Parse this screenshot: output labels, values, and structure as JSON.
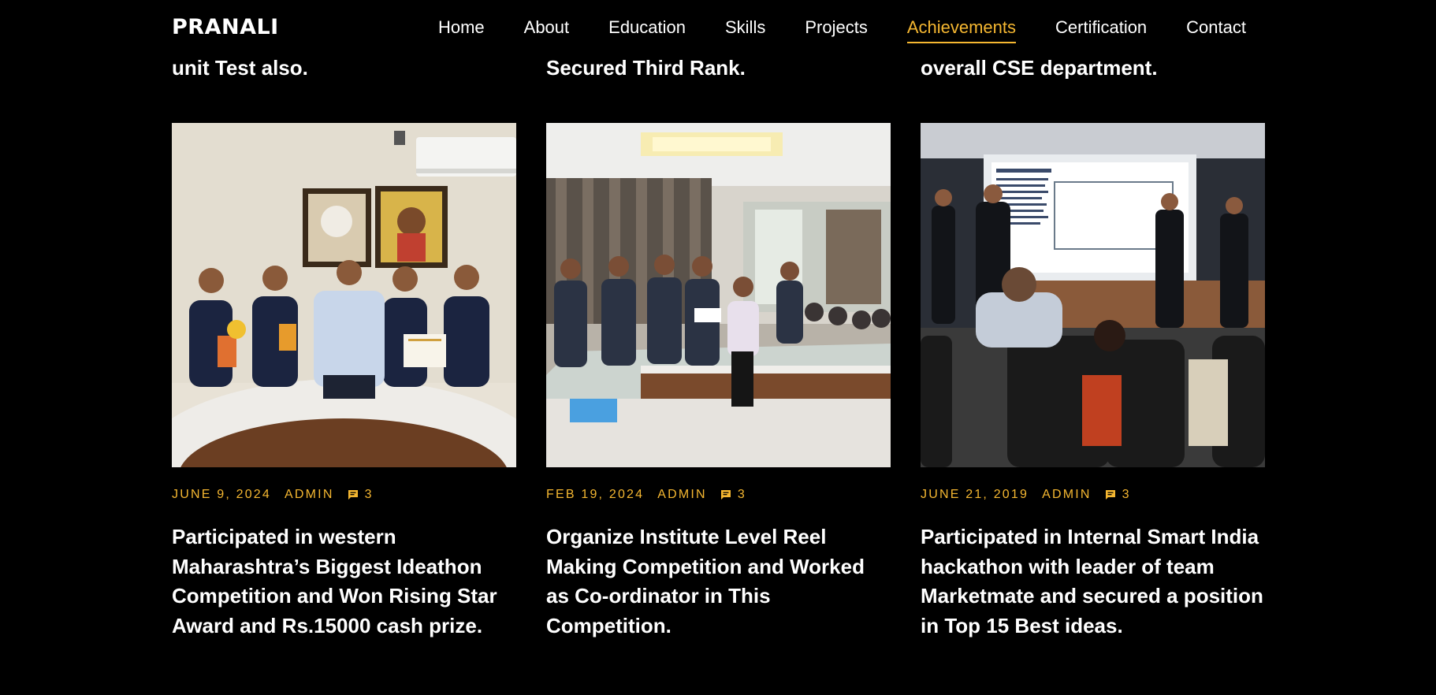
{
  "header": {
    "logo": "PRANALI",
    "nav": [
      {
        "label": "Home",
        "active": false
      },
      {
        "label": "About",
        "active": false
      },
      {
        "label": "Education",
        "active": false
      },
      {
        "label": "Skills",
        "active": false
      },
      {
        "label": "Projects",
        "active": false
      },
      {
        "label": "Achievements",
        "active": true
      },
      {
        "label": "Certification",
        "active": false
      },
      {
        "label": "Contact",
        "active": false
      }
    ]
  },
  "previous_row": [
    {
      "text": "unit Test also."
    },
    {
      "text": "Secured Third Rank."
    },
    {
      "text": "overall CSE department."
    }
  ],
  "cards": [
    {
      "date": "JUNE 9, 2024",
      "author": "ADMIN",
      "comments": "3",
      "comment_icon": "comment-icon",
      "title": "Participated in western Maharashtra’s Biggest Ideathon Competition and Won Rising Star Award and Rs.15000 cash prize."
    },
    {
      "date": "FEB 19, 2024",
      "author": "ADMIN",
      "comments": "3",
      "comment_icon": "comment-icon",
      "title": "Organize Institute Level Reel Making Competition and Worked as Co-ordinator in This Competition."
    },
    {
      "date": "JUNE 21, 2019",
      "author": "ADMIN",
      "comments": "3",
      "comment_icon": "comment-icon",
      "title": "Participated in Internal Smart India hackathon with leader of team Marketmate and secured a position in Top 15 Best ideas."
    }
  ],
  "colors": {
    "background": "#000000",
    "accent": "#f5b731",
    "text": "#ffffff"
  }
}
